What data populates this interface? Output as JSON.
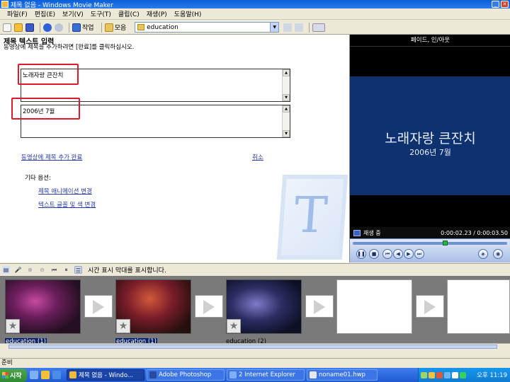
{
  "window": {
    "title": "제목 없음 - Windows Movie Maker",
    "minimize": "_",
    "close": "✕"
  },
  "menu": [
    "파일(F)",
    "편집(E)",
    "보기(V)",
    "도구(T)",
    "클립(C)",
    "재생(P)",
    "도움말(H)"
  ],
  "toolbar": {
    "tasks_label": "작업",
    "collections_label": "모음",
    "collection_value": "education",
    "dropdown_arrow": "▼"
  },
  "task_pane": {
    "title": "제목 텍스트 입력",
    "instruction": "동영상에 제목을 추가하려면 [완료]를 클릭하십시오.",
    "title_text": "노래자랑 큰잔치",
    "subtitle_text": "2006년 7월",
    "done_link": "동영상에 제목 추가 완료",
    "cancel_link": "취소",
    "other_options": "기타 옵션:",
    "change_animation": "제목 애니메이션 변경",
    "change_font": "텍스트 글꼴 및 색 변경",
    "watermark_letter": "T"
  },
  "preview": {
    "header": "페이드, 인/아웃",
    "title": "노래자랑 큰잔치",
    "subtitle": "2006년 7월",
    "status": "재생 중",
    "time": "0:00:02.23 / 0:00:03.50",
    "seek_position": 0.6
  },
  "storyboard_toolbar": {
    "label": "시간 표시 막대를 표시합니다."
  },
  "clips": [
    {
      "label": "education (1)",
      "selected": true
    },
    {
      "label": "education (1)",
      "selected": true
    },
    {
      "label": "education (2)",
      "selected": false
    }
  ],
  "status_bar": {
    "text": "준비"
  },
  "taskbar": {
    "start": "시작",
    "buttons": [
      "제목 없음 - Windo...",
      "Adobe Photoshop",
      "2 Internet Explorer",
      "noname01.hwp"
    ],
    "clock": "오후 11:19"
  },
  "colors": {
    "preview_bg": "#0e3170",
    "highlight": "#e0192a",
    "link": "#2336a8"
  }
}
